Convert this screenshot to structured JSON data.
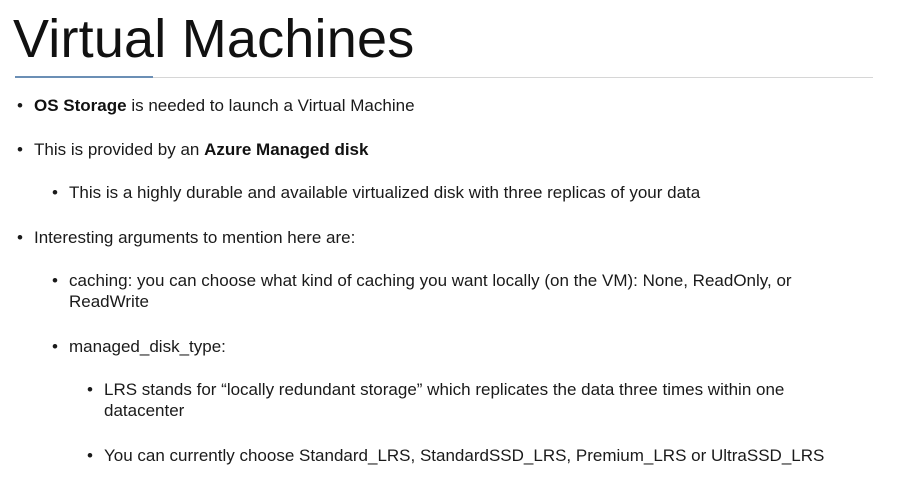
{
  "slide": {
    "title": "Virtual Machines",
    "bullet_char": "•",
    "b1": {
      "bold": "OS Storage",
      "rest": " is needed to launch a Virtual Machine"
    },
    "b2": {
      "pre": "This is provided by an ",
      "bold": "Azure Managed disk"
    },
    "b2_1": "This is a highly durable and available virtualized disk with three replicas of your data",
    "b3": "Interesting arguments to mention here are:",
    "b3_1": {
      "line1": "caching: you can choose what kind of caching you want locally (on the VM): None, ReadOnly, or",
      "line2": "ReadWrite"
    },
    "b3_2": "managed_disk_type:",
    "b3_2_1": {
      "line1": "LRS stands for “locally redundant storage” which replicates the data three times within one",
      "line2": "datacenter"
    },
    "b3_2_2": "You can currently choose Standard_LRS, StandardSSD_LRS, Premium_LRS or UltraSSD_LRS"
  }
}
